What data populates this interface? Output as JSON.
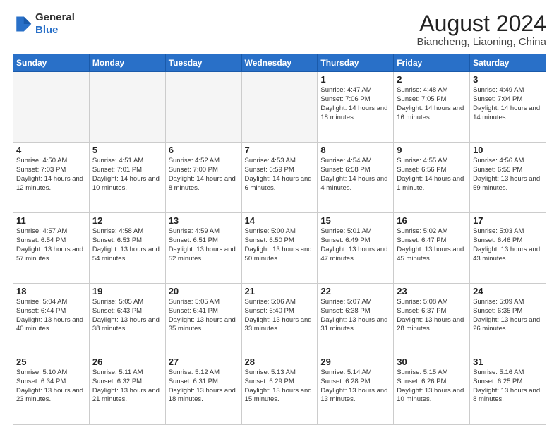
{
  "logo": {
    "general": "General",
    "blue": "Blue"
  },
  "header": {
    "month": "August 2024",
    "location": "Biancheng, Liaoning, China"
  },
  "weekdays": [
    "Sunday",
    "Monday",
    "Tuesday",
    "Wednesday",
    "Thursday",
    "Friday",
    "Saturday"
  ],
  "weeks": [
    [
      {
        "day": "",
        "info": "",
        "empty": true
      },
      {
        "day": "",
        "info": "",
        "empty": true
      },
      {
        "day": "",
        "info": "",
        "empty": true
      },
      {
        "day": "",
        "info": "",
        "empty": true
      },
      {
        "day": "1",
        "info": "Sunrise: 4:47 AM\nSunset: 7:06 PM\nDaylight: 14 hours\nand 18 minutes."
      },
      {
        "day": "2",
        "info": "Sunrise: 4:48 AM\nSunset: 7:05 PM\nDaylight: 14 hours\nand 16 minutes."
      },
      {
        "day": "3",
        "info": "Sunrise: 4:49 AM\nSunset: 7:04 PM\nDaylight: 14 hours\nand 14 minutes."
      }
    ],
    [
      {
        "day": "4",
        "info": "Sunrise: 4:50 AM\nSunset: 7:03 PM\nDaylight: 14 hours\nand 12 minutes."
      },
      {
        "day": "5",
        "info": "Sunrise: 4:51 AM\nSunset: 7:01 PM\nDaylight: 14 hours\nand 10 minutes."
      },
      {
        "day": "6",
        "info": "Sunrise: 4:52 AM\nSunset: 7:00 PM\nDaylight: 14 hours\nand 8 minutes."
      },
      {
        "day": "7",
        "info": "Sunrise: 4:53 AM\nSunset: 6:59 PM\nDaylight: 14 hours\nand 6 minutes."
      },
      {
        "day": "8",
        "info": "Sunrise: 4:54 AM\nSunset: 6:58 PM\nDaylight: 14 hours\nand 4 minutes."
      },
      {
        "day": "9",
        "info": "Sunrise: 4:55 AM\nSunset: 6:56 PM\nDaylight: 14 hours\nand 1 minute."
      },
      {
        "day": "10",
        "info": "Sunrise: 4:56 AM\nSunset: 6:55 PM\nDaylight: 13 hours\nand 59 minutes."
      }
    ],
    [
      {
        "day": "11",
        "info": "Sunrise: 4:57 AM\nSunset: 6:54 PM\nDaylight: 13 hours\nand 57 minutes."
      },
      {
        "day": "12",
        "info": "Sunrise: 4:58 AM\nSunset: 6:53 PM\nDaylight: 13 hours\nand 54 minutes."
      },
      {
        "day": "13",
        "info": "Sunrise: 4:59 AM\nSunset: 6:51 PM\nDaylight: 13 hours\nand 52 minutes."
      },
      {
        "day": "14",
        "info": "Sunrise: 5:00 AM\nSunset: 6:50 PM\nDaylight: 13 hours\nand 50 minutes."
      },
      {
        "day": "15",
        "info": "Sunrise: 5:01 AM\nSunset: 6:49 PM\nDaylight: 13 hours\nand 47 minutes."
      },
      {
        "day": "16",
        "info": "Sunrise: 5:02 AM\nSunset: 6:47 PM\nDaylight: 13 hours\nand 45 minutes."
      },
      {
        "day": "17",
        "info": "Sunrise: 5:03 AM\nSunset: 6:46 PM\nDaylight: 13 hours\nand 43 minutes."
      }
    ],
    [
      {
        "day": "18",
        "info": "Sunrise: 5:04 AM\nSunset: 6:44 PM\nDaylight: 13 hours\nand 40 minutes."
      },
      {
        "day": "19",
        "info": "Sunrise: 5:05 AM\nSunset: 6:43 PM\nDaylight: 13 hours\nand 38 minutes."
      },
      {
        "day": "20",
        "info": "Sunrise: 5:05 AM\nSunset: 6:41 PM\nDaylight: 13 hours\nand 35 minutes."
      },
      {
        "day": "21",
        "info": "Sunrise: 5:06 AM\nSunset: 6:40 PM\nDaylight: 13 hours\nand 33 minutes."
      },
      {
        "day": "22",
        "info": "Sunrise: 5:07 AM\nSunset: 6:38 PM\nDaylight: 13 hours\nand 31 minutes."
      },
      {
        "day": "23",
        "info": "Sunrise: 5:08 AM\nSunset: 6:37 PM\nDaylight: 13 hours\nand 28 minutes."
      },
      {
        "day": "24",
        "info": "Sunrise: 5:09 AM\nSunset: 6:35 PM\nDaylight: 13 hours\nand 26 minutes."
      }
    ],
    [
      {
        "day": "25",
        "info": "Sunrise: 5:10 AM\nSunset: 6:34 PM\nDaylight: 13 hours\nand 23 minutes."
      },
      {
        "day": "26",
        "info": "Sunrise: 5:11 AM\nSunset: 6:32 PM\nDaylight: 13 hours\nand 21 minutes."
      },
      {
        "day": "27",
        "info": "Sunrise: 5:12 AM\nSunset: 6:31 PM\nDaylight: 13 hours\nand 18 minutes."
      },
      {
        "day": "28",
        "info": "Sunrise: 5:13 AM\nSunset: 6:29 PM\nDaylight: 13 hours\nand 15 minutes."
      },
      {
        "day": "29",
        "info": "Sunrise: 5:14 AM\nSunset: 6:28 PM\nDaylight: 13 hours\nand 13 minutes."
      },
      {
        "day": "30",
        "info": "Sunrise: 5:15 AM\nSunset: 6:26 PM\nDaylight: 13 hours\nand 10 minutes."
      },
      {
        "day": "31",
        "info": "Sunrise: 5:16 AM\nSunset: 6:25 PM\nDaylight: 13 hours\nand 8 minutes."
      }
    ]
  ]
}
